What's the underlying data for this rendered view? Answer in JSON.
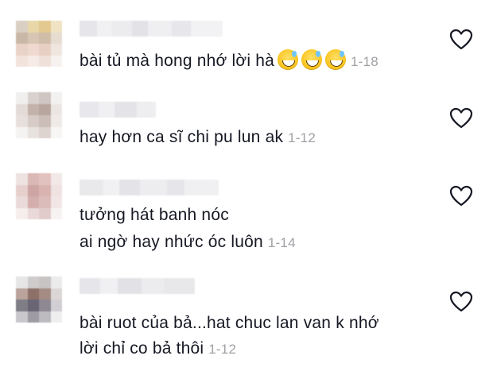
{
  "comments": [
    {
      "line1": "bài tủ mà hong nhớ lời hà",
      "emojis": [
        "sweat-smile-emoji",
        "sweat-smile-emoji",
        "sweat-smile-emoji"
      ],
      "date": "1-18",
      "line2": ""
    },
    {
      "line1": "hay hơn ca sĩ chi pu lun ak",
      "date": "1-12",
      "line2": ""
    },
    {
      "line1": "tưởng hát banh nóc",
      "line2": "ai ngờ hay nhức óc luôn",
      "date": "1-14"
    },
    {
      "line1": "bài ruot của bả...hat chuc lan van k nhớ",
      "line2": "lời chỉ co bả thôi",
      "date": "1-12"
    }
  ],
  "icons": {
    "like": "heart-outline-icon"
  },
  "colors": {
    "text": "#161823",
    "date": "#a1a1a6",
    "icon": "#161823"
  }
}
